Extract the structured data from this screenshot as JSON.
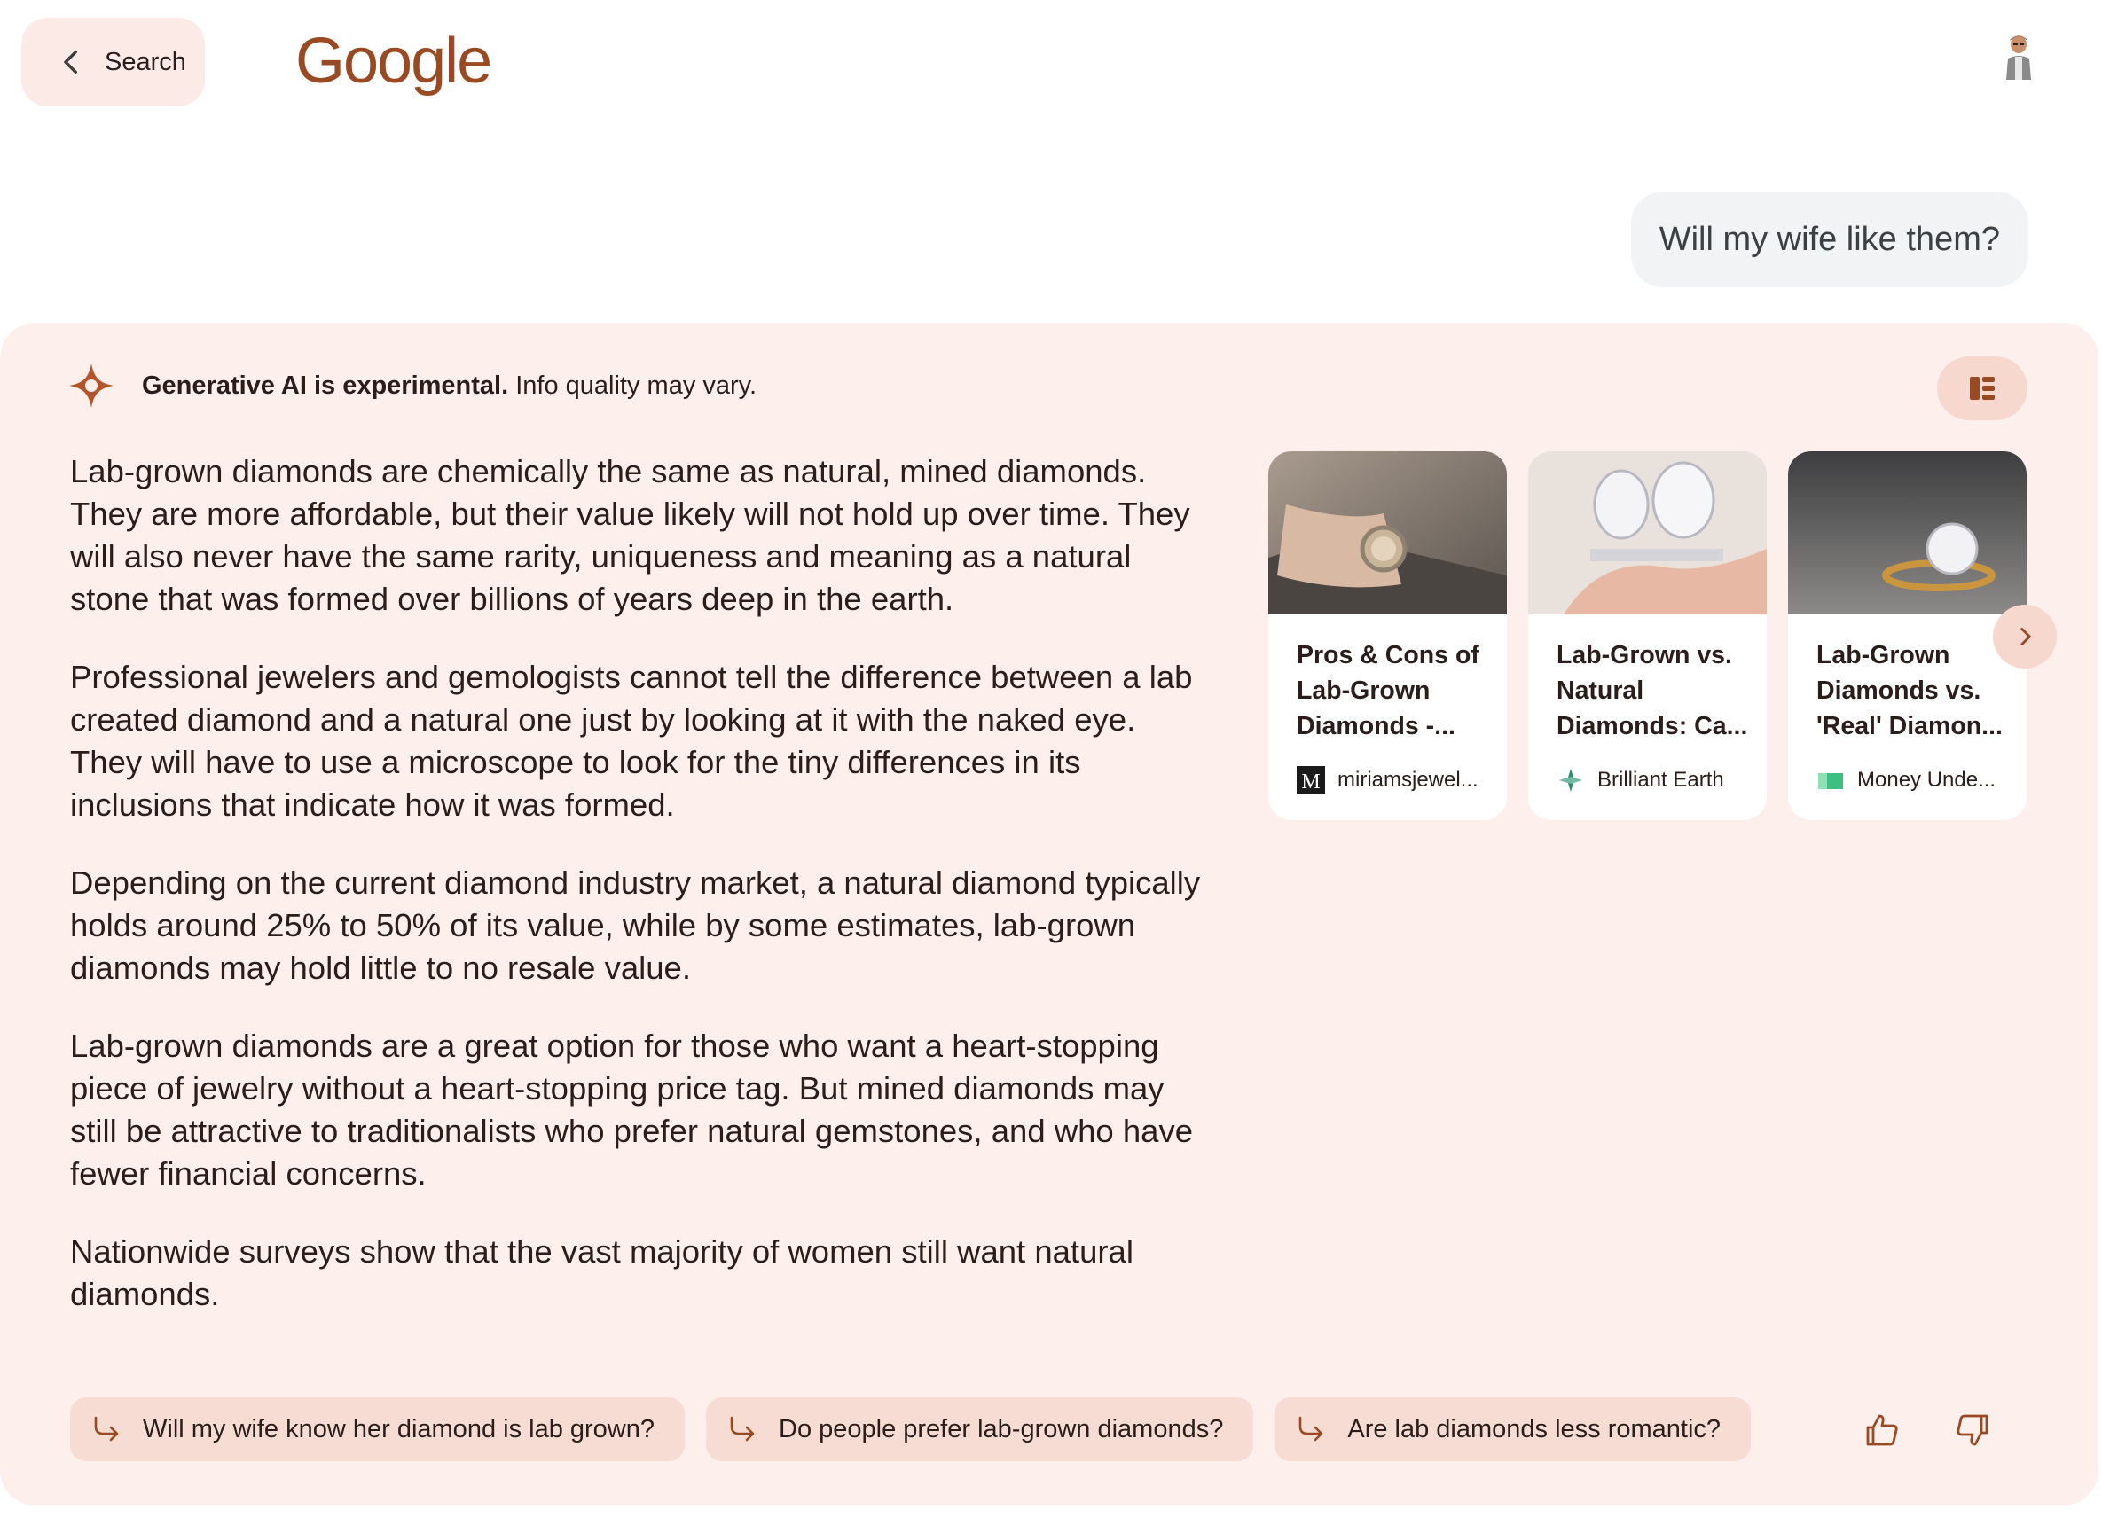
{
  "header": {
    "back_label": "Search",
    "logo_text": "Google"
  },
  "query": "Will my wife like them?",
  "panel": {
    "disclaimer_bold": "Generative AI is experimental.",
    "disclaimer_rest": " Info quality may vary.",
    "paragraphs": [
      "Lab-grown diamonds are chemically the same as natural, mined diamonds. They are more affordable, but their value likely will not hold up over time. They will also never have the same rarity, uniqueness and meaning as a natural stone that was formed over billions of years deep in the earth.",
      "Professional jewelers and gemologists cannot tell the difference between a lab created diamond and a natural one just by looking at it with the naked eye. They will have to use a microscope to look for the tiny differences in its inclusions that indicate how it was formed.",
      "Depending on the current diamond industry market, a natural diamond typically holds around 25% to 50% of its value, while by some estimates, lab-grown diamonds may hold little to no resale value.",
      "Lab-grown diamonds are a great option for those who want a heart-stopping piece of jewelry without a heart-stopping price tag. But mined diamonds may still be attractive to traditionalists who prefer natural gemstones, and who have fewer financial concerns.",
      "Nationwide surveys show that the vast majority of women still want natural diamonds."
    ],
    "sources": [
      {
        "title": "Pros & Cons of Lab-Grown Diamonds -...",
        "site": "miriamsjewel...",
        "icon": "miriams-logo-icon"
      },
      {
        "title": "Lab-Grown vs. Natural Diamonds: Ca...",
        "site": "Brilliant Earth",
        "icon": "brilliant-earth-logo-icon"
      },
      {
        "title": "Lab-Grown Diamonds vs. 'Real' Diamon...",
        "site": "Money Unde...",
        "icon": "money-under-logo-icon"
      }
    ],
    "followups": [
      "Will my wife know her diamond is lab grown?",
      "Do people prefer lab-grown diamonds?",
      "Are lab diamonds less romantic?"
    ]
  },
  "colors": {
    "accent": "#9a4a23",
    "panel_bg": "#fcefec",
    "chip_bg": "#f7dcd3",
    "query_bg": "#f1f3f4"
  }
}
